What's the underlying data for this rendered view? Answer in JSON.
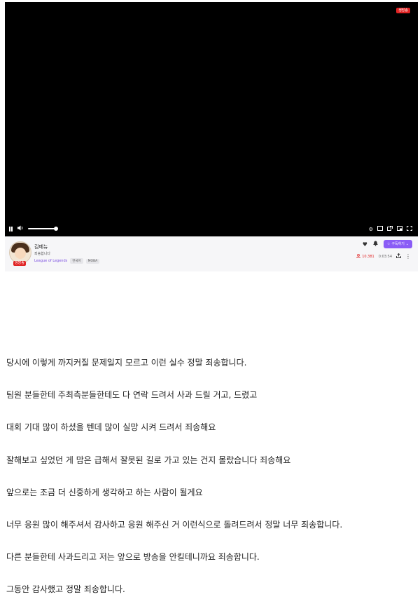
{
  "player": {
    "live_badge": "생방송",
    "controls": {
      "left": [
        "pause-icon",
        "volume-icon"
      ],
      "right": [
        "settings-icon",
        "theater-icon",
        "popout-icon",
        "pip-icon",
        "fullscreen-icon"
      ]
    }
  },
  "channel": {
    "name": "김메뉴",
    "title": "죄송합니다",
    "avatar_badge": "생방송",
    "category": "League of Legends",
    "tags": [
      "한국어",
      "MOBA"
    ],
    "subscribe_label": "구독하기",
    "viewers": "10,381",
    "uptime": "0:03:54"
  },
  "post": {
    "lines": [
      "당시에 이렇게 까지커질 문제일지 모르고 이런 실수 정말 죄송합니다.",
      "팀원 분들한테 주최측분들한테도 다 연락 드려서 사과 드릴 거고, 드렸고",
      "대회 기대 많이 하셨을 텐데 많이 실망 시켜 드려서 죄송해요",
      "잘해보고 싶었던 게 맘은 급해서 잘못된 길로 가고 있는 건지 몰랐습니다 죄송해요",
      "앞으로는 조금 더 신중하게 생각하고 하는 사람이 될게요",
      "너무 응원 많이 해주셔서 감사하고 응원 해주신 거 이런식으로 돌려드려서 정말 너무 죄송합니다.",
      "다른 분들한테 사과드리고 저는 앞으로 방송을 안킬테니까요 죄송합니다.",
      "그동안 감사했고 정말 죄송합니다."
    ]
  },
  "colors": {
    "live_red": "#e02424",
    "subscribe_purple": "#8a5cf6",
    "category_purple": "#7a4de0"
  }
}
